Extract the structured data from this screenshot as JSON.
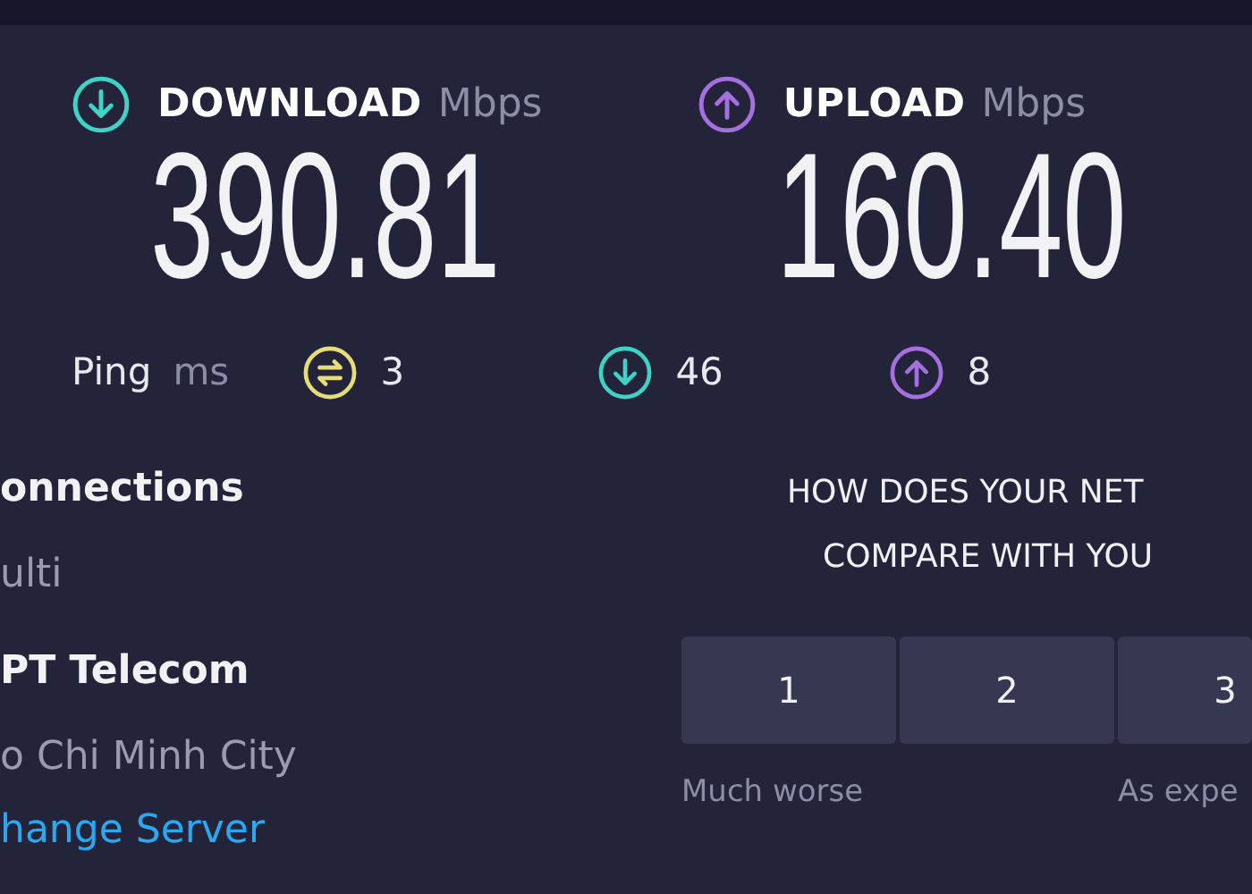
{
  "metrics": [
    {
      "kind": "download",
      "label": "DOWNLOAD",
      "unit": "Mbps",
      "value": "390.81"
    },
    {
      "kind": "upload",
      "label": "UPLOAD",
      "unit": "Mbps",
      "value": "160.40"
    }
  ],
  "ping": {
    "label": "Ping",
    "unit": "ms",
    "values": [
      {
        "kind": "idle",
        "value": "3"
      },
      {
        "kind": "download",
        "value": "46"
      },
      {
        "kind": "upload",
        "value": "8"
      }
    ]
  },
  "connections": {
    "label": "onnections",
    "value": "ulti"
  },
  "server": {
    "name": "PT Telecom",
    "location": "o Chi Minh City",
    "link": "hange Server"
  },
  "rating": {
    "question": [
      "HOW DOES YOUR NET",
      "COMPARE WITH YOU"
    ],
    "options": [
      "1",
      "2",
      "3"
    ],
    "scale_labels": [
      "Much worse",
      "As expe"
    ]
  }
}
